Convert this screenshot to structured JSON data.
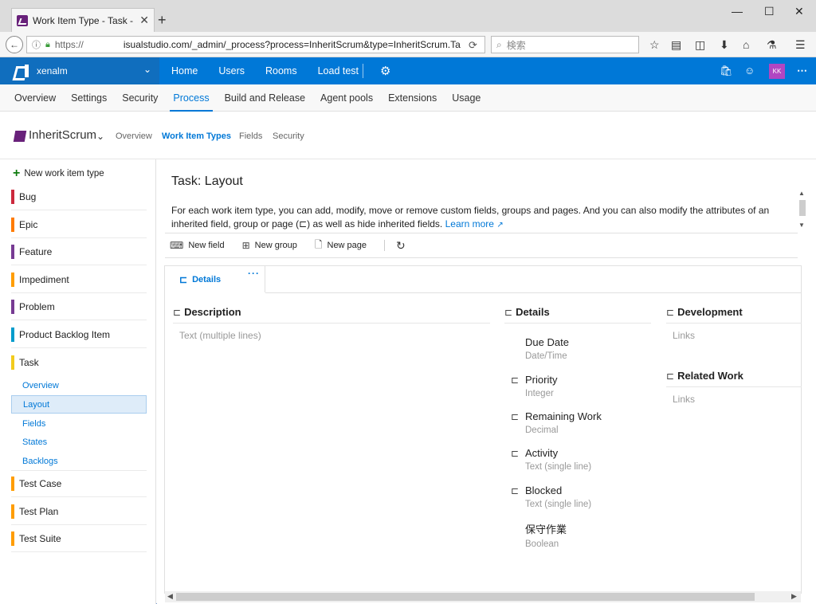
{
  "browser": {
    "tab_title": "Work Item Type - Task - I...",
    "url_prefix": "https://",
    "url_rest": "isualstudio.com/_admin/_process?process=InheritScrum&type=InheritScrum.Ta",
    "search_placeholder": "検索"
  },
  "header": {
    "account": "xenalm",
    "nav": [
      "Home",
      "Users",
      "Rooms",
      "Load test"
    ],
    "avatar_initials": "KK"
  },
  "admin_tabs": [
    "Overview",
    "Settings",
    "Security",
    "Process",
    "Build and Release",
    "Agent pools",
    "Extensions",
    "Usage"
  ],
  "admin_active": "Process",
  "process": {
    "name": "InheritScrum",
    "subnav": [
      "Overview",
      "Work Item Types",
      "Fields",
      "Security"
    ],
    "active": "Work Item Types"
  },
  "leftnav": {
    "new_label": "New work item type",
    "items": [
      {
        "label": "Bug",
        "color": "#cc293d"
      },
      {
        "label": "Epic",
        "color": "#ff7b00"
      },
      {
        "label": "Feature",
        "color": "#773b93"
      },
      {
        "label": "Impediment",
        "color": "#ff9d00"
      },
      {
        "label": "Problem",
        "color": "#773b93"
      },
      {
        "label": "Product Backlog Item",
        "color": "#009ccc"
      },
      {
        "label": "Task",
        "color": "#f2cb1d"
      },
      {
        "label": "Test Case",
        "color": "#ff9d00"
      },
      {
        "label": "Test Plan",
        "color": "#ff9d00"
      },
      {
        "label": "Test Suite",
        "color": "#ff9d00"
      }
    ],
    "task_sub": [
      "Overview",
      "Layout",
      "Fields",
      "States",
      "Backlogs"
    ],
    "task_sub_selected": "Layout"
  },
  "main": {
    "title": "Task: Layout",
    "desc_1": "For each work item type, you can add, modify, move or remove custom fields, groups and pages. And you can also modify the attributes of an inherited field, group or page (",
    "desc_2": ") as well as hide inherited fields.",
    "learn_more": "Learn more",
    "toolbar": {
      "new_field": "New field",
      "new_group": "New group",
      "new_page": "New page"
    },
    "page_tab": "Details",
    "groups": {
      "description": {
        "title": "Description",
        "field": "Text (multiple lines)"
      },
      "details": {
        "title": "Details",
        "fields": [
          {
            "label": "Due Date",
            "type": "Date/Time",
            "inherited": false
          },
          {
            "label": "Priority",
            "type": "Integer",
            "inherited": true
          },
          {
            "label": "Remaining Work",
            "type": "Decimal",
            "inherited": true
          },
          {
            "label": "Activity",
            "type": "Text (single line)",
            "inherited": true
          },
          {
            "label": "Blocked",
            "type": "Text (single line)",
            "inherited": true
          },
          {
            "label": "保守作業",
            "type": "Boolean",
            "inherited": false
          }
        ]
      },
      "development": {
        "title": "Development",
        "field": "Links"
      },
      "related_work": {
        "title": "Related Work",
        "field": "Links"
      }
    }
  }
}
